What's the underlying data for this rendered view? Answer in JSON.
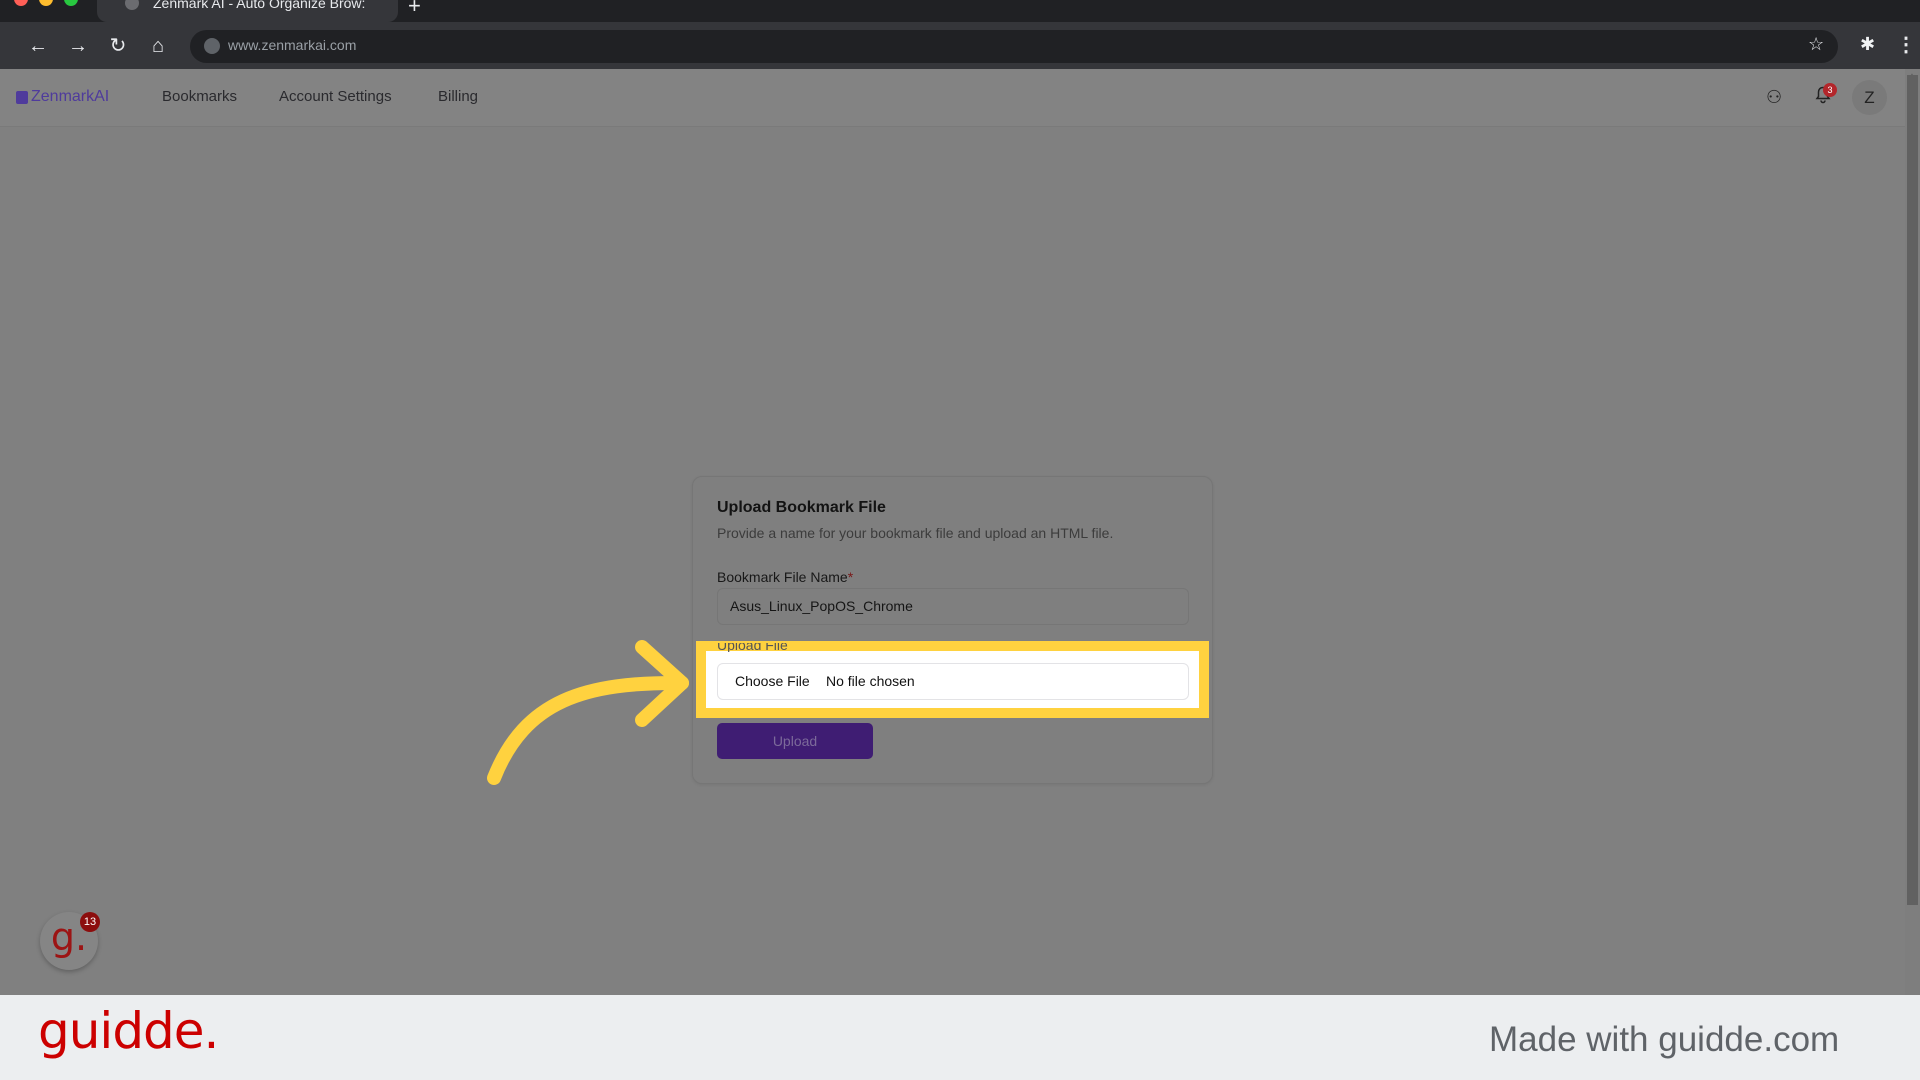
{
  "browser": {
    "tab_title": "Zenmark AI - Auto Organize Brow:",
    "new_tab": "+",
    "url": "www.zenmarkai.com",
    "icons": {
      "back": "←",
      "forward": "→",
      "reload": "↻",
      "home": "⌂",
      "star": "☆",
      "extensions": "✱",
      "menu": "⋮"
    }
  },
  "app": {
    "logo": "ZenmarkAI",
    "nav": [
      {
        "label": "Bookmarks"
      },
      {
        "label": "Account Settings"
      },
      {
        "label": "Billing"
      }
    ],
    "credits_icon": "⚇",
    "bell_icon": "🔔",
    "notification_count": "3",
    "avatar_initial": "Z"
  },
  "form": {
    "title": "Upload Bookmark File",
    "subtitle": "Provide a name for your bookmark file and upload an HTML file.",
    "name_label": "Bookmark File Name",
    "required_mark": "*",
    "name_value": "Asus_Linux_PopOS_Chrome",
    "file_label": "Upload File",
    "choose_file": "Choose File",
    "no_file": "No file chosen",
    "upload_button": "Upload"
  },
  "overlay": {
    "highlight_color": "#ffd23f",
    "widget_glyph": "g.",
    "widget_badge": "13"
  },
  "footer": {
    "logo": "guidde.",
    "made_with": "Made with guidde.com"
  },
  "colors": {
    "brand": "#4f3b9c",
    "upload_button": "#3f1d73",
    "guidde_red": "#cc0000"
  }
}
